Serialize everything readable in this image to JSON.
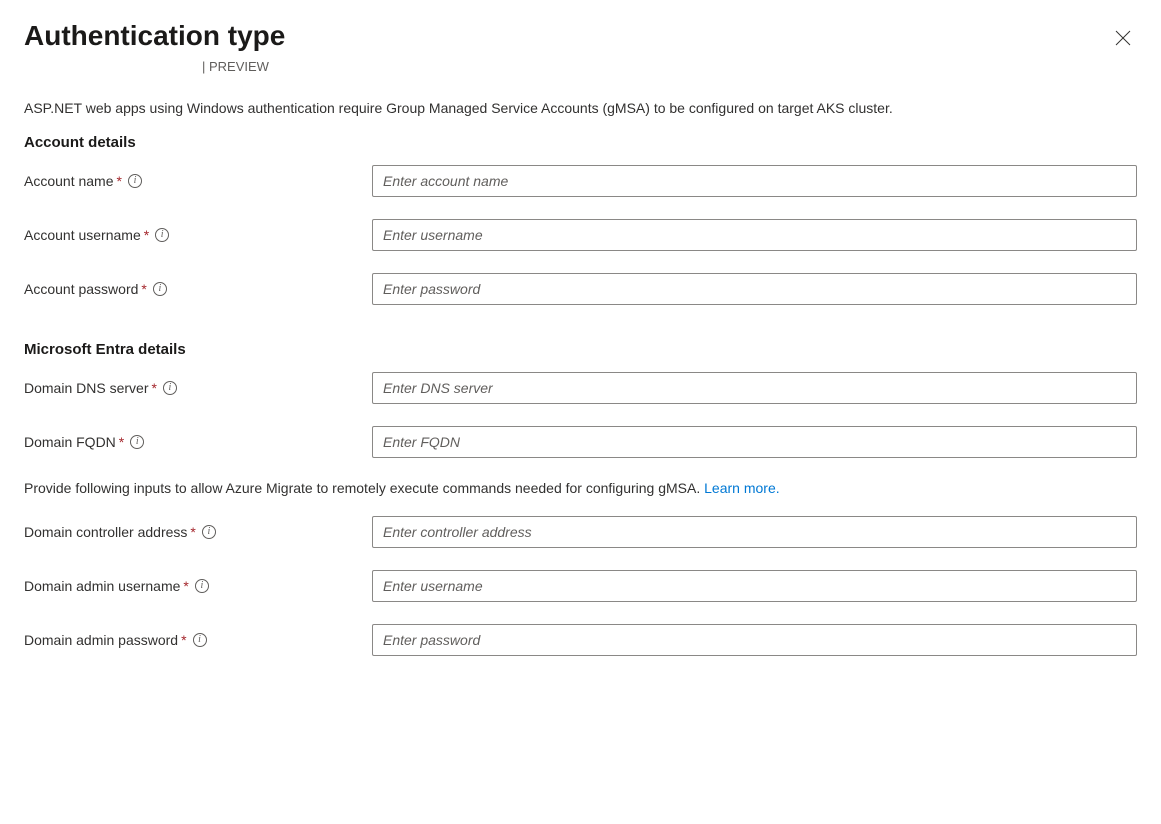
{
  "header": {
    "title": "Authentication type",
    "preview": "| PREVIEW"
  },
  "description": "ASP.NET web apps using Windows authentication require Group Managed Service Accounts (gMSA) to be configured on target AKS cluster.",
  "sections": {
    "account": {
      "heading": "Account details",
      "fields": {
        "accountName": {
          "label": "Account name",
          "placeholder": "Enter account name"
        },
        "accountUsername": {
          "label": "Account username",
          "placeholder": "Enter username"
        },
        "accountPassword": {
          "label": "Account password",
          "placeholder": "Enter password"
        }
      }
    },
    "entra": {
      "heading": "Microsoft Entra details",
      "fields": {
        "dnsServer": {
          "label": "Domain DNS server",
          "placeholder": "Enter DNS server"
        },
        "fqdn": {
          "label": "Domain FQDN",
          "placeholder": "Enter FQDN"
        },
        "helperText": "Provide following inputs to allow Azure Migrate to remotely execute commands needed for configuring gMSA. ",
        "learnMore": "Learn more.",
        "controllerAddress": {
          "label": "Domain controller address",
          "placeholder": "Enter controller address"
        },
        "adminUsername": {
          "label": "Domain admin username",
          "placeholder": "Enter username"
        },
        "adminPassword": {
          "label": "Domain admin password",
          "placeholder": "Enter password"
        }
      }
    }
  },
  "symbols": {
    "required": "*",
    "info": "i"
  }
}
